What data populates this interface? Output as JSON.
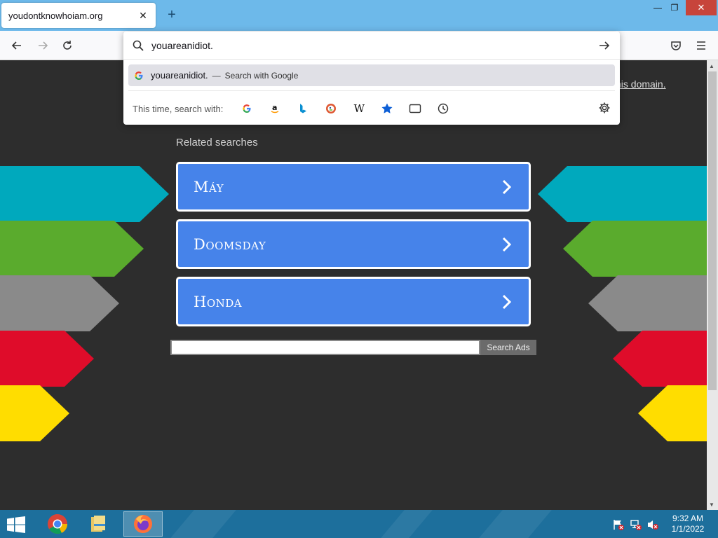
{
  "browser": {
    "tab_title": "youdontknowhoiam.org",
    "tab_close_glyph": "✕",
    "new_tab_glyph": "+",
    "window_controls": {
      "minimize": "—",
      "maximize": "❐",
      "close": "✕"
    }
  },
  "urlbar": {
    "value": "youareanidiot.",
    "suggestion_text": "youareanidiot.",
    "suggestion_separator": "—",
    "suggestion_action": "Search with Google",
    "engines_label": "This time, search with:",
    "engines": [
      "google-icon",
      "amazon-icon",
      "bing-icon",
      "duckduckgo-icon",
      "wikipedia-icon",
      "bookmarks-icon",
      "tabs-icon",
      "history-icon"
    ],
    "wikipedia_glyph": "W",
    "amazon_glyph": "a"
  },
  "page": {
    "domain_link": "his domain.",
    "related_heading": "Related searches",
    "related": [
      {
        "label": "Máy"
      },
      {
        "label": "Doomsday"
      },
      {
        "label": "Honda"
      }
    ],
    "search_ads_button": "Search Ads",
    "search_ads_value": ""
  },
  "arrow_colors": [
    "#00a9bd",
    "#5aab2d",
    "#8a8a8a",
    "#df0c2a",
    "#ffdd00"
  ],
  "taskbar": {
    "apps": [
      "chrome-icon",
      "file-explorer-icon",
      "firefox-icon"
    ],
    "clock_time": "9:32 AM",
    "clock_date": "1/1/2022"
  }
}
